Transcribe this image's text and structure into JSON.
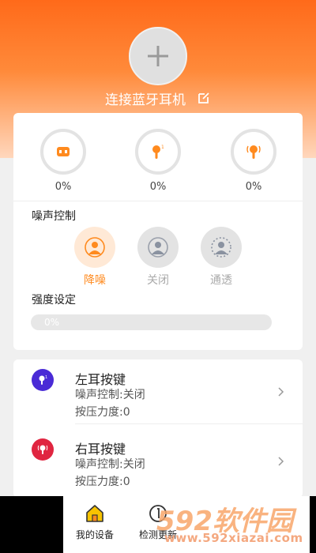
{
  "header": {
    "connect_label": "连接蓝牙耳机",
    "add_icon": "plus-icon",
    "edit_icon": "edit-icon"
  },
  "batteries": [
    {
      "name": "case",
      "icon": "charging-case-icon",
      "value": "0%"
    },
    {
      "name": "left",
      "icon": "left-earbud-icon",
      "value": "0%"
    },
    {
      "name": "right",
      "icon": "right-earbud-icon",
      "value": "0%"
    }
  ],
  "noise_control": {
    "title": "噪声控制",
    "modes": [
      {
        "label": "降噪",
        "icon": "noise-cancel-icon",
        "active": true
      },
      {
        "label": "关闭",
        "icon": "person-icon",
        "active": false
      },
      {
        "label": "通透",
        "icon": "transparency-icon",
        "active": false
      }
    ]
  },
  "strength": {
    "title": "强度设定",
    "value": "0%",
    "fraction": 0
  },
  "earbuds": [
    {
      "title": "左耳按键",
      "noise_line": "噪声控制:关闭",
      "pressure_line": "按压力度:0",
      "color": "#4a2bd6",
      "icon": "left-earbud-icon"
    },
    {
      "title": "右耳按键",
      "noise_line": "噪声控制:关闭",
      "pressure_line": "按压力度:0",
      "color": "#e02540",
      "icon": "right-earbud-icon"
    }
  ],
  "bottom_nav": {
    "tabs": [
      {
        "label": "我的设备",
        "icon": "home-icon"
      },
      {
        "label": "检测更新",
        "icon": "update-icon"
      }
    ]
  },
  "watermark": {
    "brand": "592软件园",
    "url": "www.592xiazai.com"
  },
  "colors": {
    "accent": "#ff8a1e",
    "header_top": "#ff6a1a"
  }
}
